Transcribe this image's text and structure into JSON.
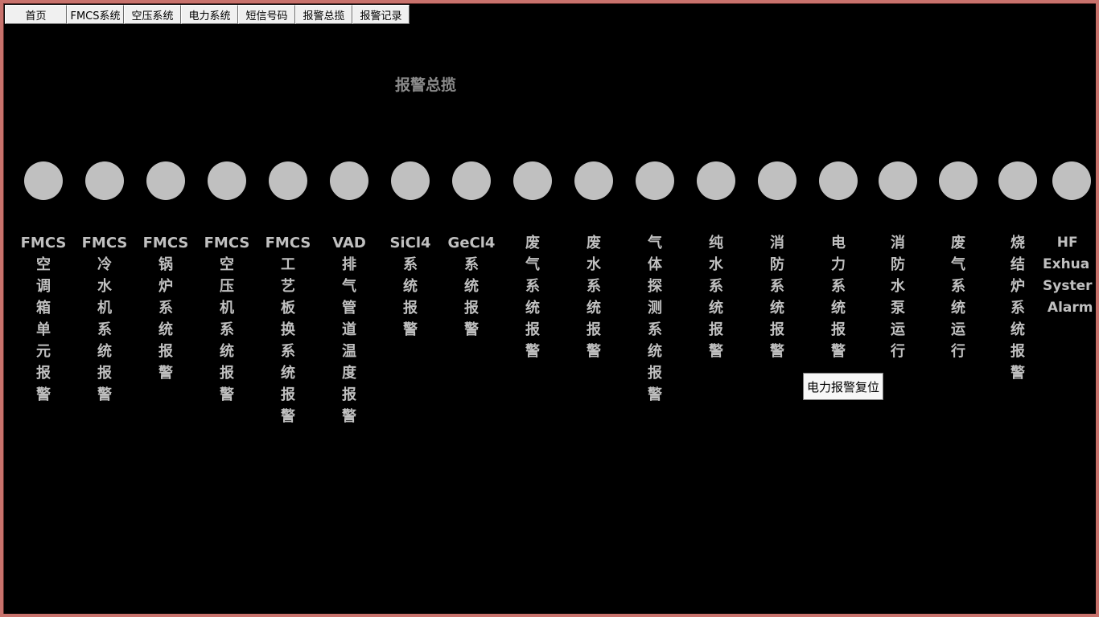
{
  "nav": {
    "items": [
      {
        "label": "首页"
      },
      {
        "label": "FMCS系统"
      },
      {
        "label": "空压系统"
      },
      {
        "label": "电力系统"
      },
      {
        "label": "短信号码"
      },
      {
        "label": "报警总揽"
      },
      {
        "label": "报警记录"
      }
    ]
  },
  "page": {
    "title": "报警总揽"
  },
  "colors": {
    "frame_border": "#c8726c",
    "background": "#000000",
    "lamp_off": "#c0c0c0",
    "label": "#c0c0c0",
    "title": "#8a8a8a"
  },
  "alarms": [
    {
      "label": "FMCS\n空\n调\n箱\n单\n元\n报\n警",
      "state": "off"
    },
    {
      "label": "FMCS\n冷\n水\n机\n系\n统\n报\n警",
      "state": "off"
    },
    {
      "label": "FMCS\n锅\n炉\n系\n统\n报\n警",
      "state": "off"
    },
    {
      "label": "FMCS\n空\n压\n机\n系\n统\n报\n警",
      "state": "off"
    },
    {
      "label": "FMCS\n工\n艺\n板\n换\n系\n统\n报\n警",
      "state": "off"
    },
    {
      "label": "VAD\n排\n气\n管\n道\n温\n度\n报\n警",
      "state": "off"
    },
    {
      "label": "SiCl4\n系\n统\n报\n警",
      "state": "off"
    },
    {
      "label": "GeCl4\n系\n统\n报\n警",
      "state": "off"
    },
    {
      "label": "废\n气\n系\n统\n报\n警",
      "state": "off"
    },
    {
      "label": "废\n水\n系\n统\n报\n警",
      "state": "off"
    },
    {
      "label": "气\n体\n探\n测\n系\n统\n报\n警",
      "state": "off"
    },
    {
      "label": "纯\n水\n系\n统\n报\n警",
      "state": "off"
    },
    {
      "label": "消\n防\n系\n统\n报\n警",
      "state": "off"
    },
    {
      "label": "电\n力\n系\n统\n报\n警",
      "state": "off"
    },
    {
      "label": "消\n防\n水\n泵\n运\n行",
      "state": "off"
    },
    {
      "label": "废\n气\n系\n统\n运\n行",
      "state": "off"
    },
    {
      "label": "烧\n结\n炉\n系\n统\n报\n警",
      "state": "off"
    },
    {
      "label": "   HF\nExhua\nSyster\n Alarm",
      "state": "off"
    }
  ],
  "reset_button": {
    "label": "电力报警复位"
  }
}
